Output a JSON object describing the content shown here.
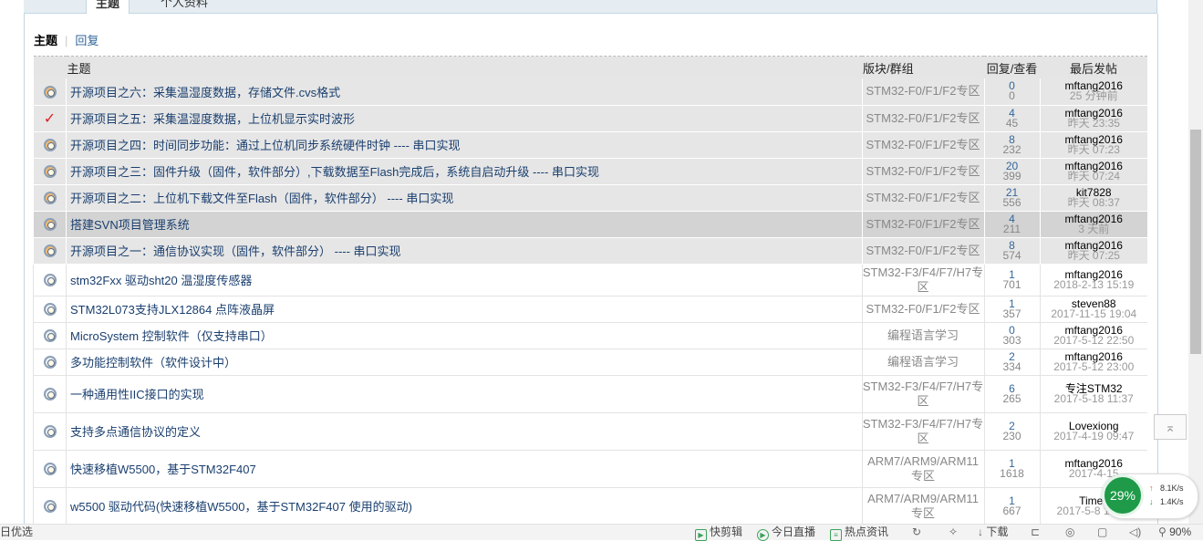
{
  "tabs": {
    "topics": "主题",
    "profile": "个人资料"
  },
  "subtabs": {
    "current": "主题",
    "separator": "|",
    "replies": "回复"
  },
  "table": {
    "headers": {
      "subject": "主题",
      "forum": "版块/群组",
      "replies_views": "回复/查看",
      "last_post": "最后发帖"
    },
    "rows": [
      {
        "icon": "thread-icon",
        "title": "开源项目之六：采集温湿度数据，存储文件.cvs格式",
        "forum": "STM32-F0/F1/F2专区",
        "replies": "0",
        "views": "0",
        "author": "mftang2016",
        "time": "25 分钟前"
      },
      {
        "icon": "checkmark-icon",
        "title": "开源项目之五：采集温湿度数据，上位机显示实时波形",
        "forum": "STM32-F0/F1/F2专区",
        "replies": "4",
        "views": "45",
        "author": "mftang2016",
        "time": "昨天 23:35"
      },
      {
        "icon": "thread-icon",
        "title": "开源项目之四：时间同步功能：通过上位机同步系统硬件时钟 ---- 串口实现",
        "forum": "STM32-F0/F1/F2专区",
        "replies": "8",
        "views": "232",
        "author": "mftang2016",
        "time": "昨天 07:23"
      },
      {
        "icon": "thread-icon",
        "title": "开源项目之三：固件升级（固件，软件部分）,下载数据至Flash完成后，系统自启动升级 ---- 串口实现",
        "forum": "STM32-F0/F1/F2专区",
        "replies": "20",
        "views": "399",
        "author": "mftang2016",
        "time": "昨天 07:24"
      },
      {
        "icon": "thread-icon",
        "title": "开源项目之二：上位机下载文件至Flash（固件，软件部分） ---- 串口实现",
        "forum": "STM32-F0/F1/F2专区",
        "replies": "21",
        "views": "556",
        "author": "kit7828",
        "time": "昨天 08:37"
      },
      {
        "icon": "thread-icon",
        "title": "搭建SVN项目管理系统",
        "forum": "STM32-F0/F1/F2专区",
        "replies": "4",
        "views": "211",
        "author": "mftang2016",
        "time": "3 天前"
      },
      {
        "icon": "thread-icon",
        "title": "开源项目之一：通信协议实现（固件，软件部分） ---- 串口实现",
        "forum": "STM32-F0/F1/F2专区",
        "replies": "8",
        "views": "574",
        "author": "mftang2016",
        "time": "昨天 07:25"
      },
      {
        "icon": "thread-icon",
        "title": "stm32Fxx 驱动sht20 温湿度传感器",
        "forum": "STM32-F3/F4/F7/H7专区",
        "replies": "1",
        "views": "701",
        "author": "mftang2016",
        "time": "2018-2-13 15:19"
      },
      {
        "icon": "thread-icon",
        "title": "STM32L073支持JLX12864 点阵液晶屏",
        "forum": "STM32-F0/F1/F2专区",
        "replies": "1",
        "views": "357",
        "author": "steven88",
        "time": "2017-11-15 19:04"
      },
      {
        "icon": "thread-icon",
        "title": "MicroSystem 控制软件（仅支持串口）",
        "forum": "编程语言学习",
        "replies": "0",
        "views": "303",
        "author": "mftang2016",
        "time": "2017-5-12 22:50"
      },
      {
        "icon": "thread-icon",
        "title": "多功能控制软件（软件设计中）",
        "forum": "编程语言学习",
        "replies": "2",
        "views": "334",
        "author": "mftang2016",
        "time": "2017-5-12 23:00"
      },
      {
        "icon": "thread-icon",
        "title": "一种通用性IIC接口的实现",
        "forum": "STM32-F3/F4/F7/H7专区",
        "replies": "6",
        "views": "265",
        "author": "专注STM32",
        "time": "2017-5-18 11:37"
      },
      {
        "icon": "thread-icon",
        "title": "支持多点通信协议的定义",
        "forum": "STM32-F3/F4/F7/H7专区",
        "replies": "2",
        "views": "230",
        "author": "Lovexiong",
        "time": "2017-4-19 09:47"
      },
      {
        "icon": "thread-icon",
        "title": "快速移植W5500，基于STM32F407",
        "forum": "ARM7/ARM9/ARM11专区",
        "replies": "1",
        "views": "1618",
        "author": "mftang2016",
        "time": "2017-4-15"
      },
      {
        "icon": "thread-icon",
        "title": "w5500 驱动代码(快速移植W5500，基于STM32F407 使用的驱动)",
        "forum": "ARM7/ARM9/ARM11专区",
        "replies": "1",
        "views": "667",
        "author": "Timec",
        "time": "2017-5-8 16:46"
      }
    ]
  },
  "speed": {
    "percent": "29%",
    "up": "8.1K/s",
    "down": "1.4K/s"
  },
  "statusbar": {
    "left": "日优选",
    "items": [
      "快剪辑",
      "今日直播",
      "热点资讯",
      "下载"
    ],
    "zoom": "90%"
  },
  "colors": {
    "accent": "#336699",
    "gauge": "#1e9a48",
    "row_bg": "#e6e6e6"
  }
}
